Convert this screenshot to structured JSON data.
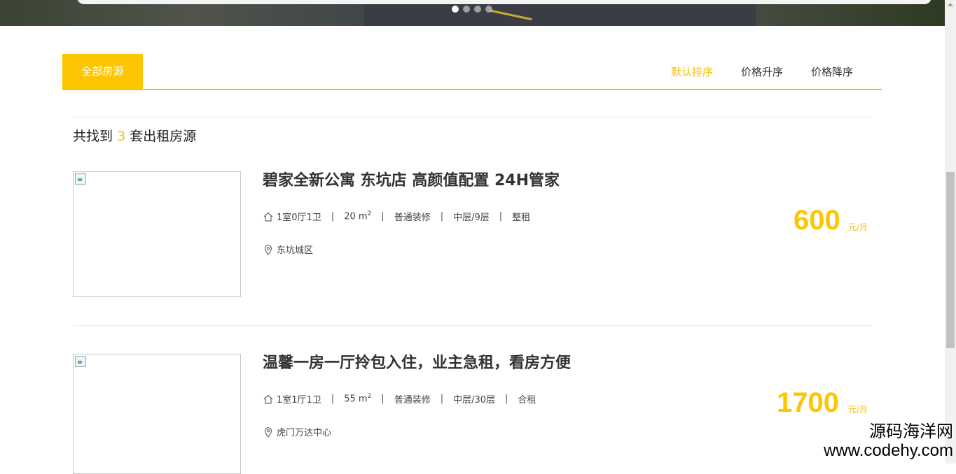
{
  "banner": {
    "dot_count": 4,
    "active_dot": 0
  },
  "tabs": {
    "all_label": "全部房源"
  },
  "sort": {
    "default_label": "默认排序",
    "price_asc_label": "价格升序",
    "price_desc_label": "价格降序"
  },
  "summary": {
    "prefix": "共找到",
    "count": "3",
    "suffix": "套出租房源"
  },
  "listings": [
    {
      "title": "碧家全新公寓 东坑店 高颜值配置 24H管家",
      "layout": "1室0厅1卫",
      "area": "20 m",
      "area_sup": "2",
      "decoration": "普通装修",
      "floor": "中层/9层",
      "rent_type": "整租",
      "location": "东坑城区",
      "price": "600",
      "unit": "元/月"
    },
    {
      "title": "温馨一房一厅拎包入住，业主急租，看房方便",
      "layout": "1室1厅1卫",
      "area": "55 m",
      "area_sup": "2",
      "decoration": "普通装修",
      "floor": "中层/30层",
      "rent_type": "合租",
      "location": "虎门万达中心",
      "price": "1700",
      "unit": "元/月"
    }
  ],
  "watermark": {
    "line1": "源码海洋网",
    "line2": "www.codehy.com"
  },
  "colors": {
    "accent": "#fdc603",
    "accent_text": "#f5c10b"
  },
  "icons": {
    "house": "house-icon",
    "location": "location-pin-icon"
  }
}
